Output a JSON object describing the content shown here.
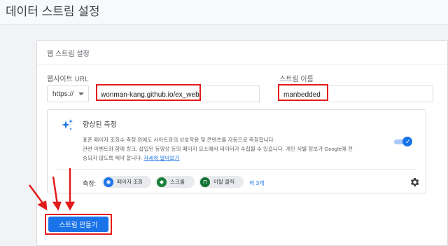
{
  "page": {
    "title": "데이터 스트림 설정"
  },
  "panel": {
    "header": "웹 스트림 설정",
    "website_url_label": "웹사이트 URL",
    "protocol": "https://",
    "url_value": "wonman-kang.github.io/ex_web/",
    "stream_name_label": "스트림 이름",
    "stream_name_value": "manbedded"
  },
  "enhanced": {
    "title": "향상된 측정",
    "description_1": "표준 페이지 조회수 측정 외에도 사이트와의 상호작용 및 콘텐츠를 자동으로 측정합니다.",
    "description_2": "관련 이벤트와 함께 링크, 삽입된 동영상 등의 페이지 요소에서 데이터가 수집될 수 있습니다. 개인 식별 정보가 Google에 전",
    "description_3": "송되지 않도록 해야 합니다.",
    "learn_more": "자세히 알아보기",
    "toggle_on": true,
    "measure_label": "측정:",
    "chips": [
      {
        "label": "페이지 조회",
        "icon": "eye-icon",
        "color": "#1a73e8"
      },
      {
        "label": "스크롤",
        "icon": "diamond-arrow-icon",
        "color": "#188038"
      },
      {
        "label": "이탈 클릭",
        "icon": "mouse-icon",
        "color": "#137333"
      }
    ],
    "more": "외 3개"
  },
  "actions": {
    "create_button": "스트림 만들기"
  },
  "colors": {
    "accent": "#1a73e8",
    "highlight": "#e21b1b"
  }
}
